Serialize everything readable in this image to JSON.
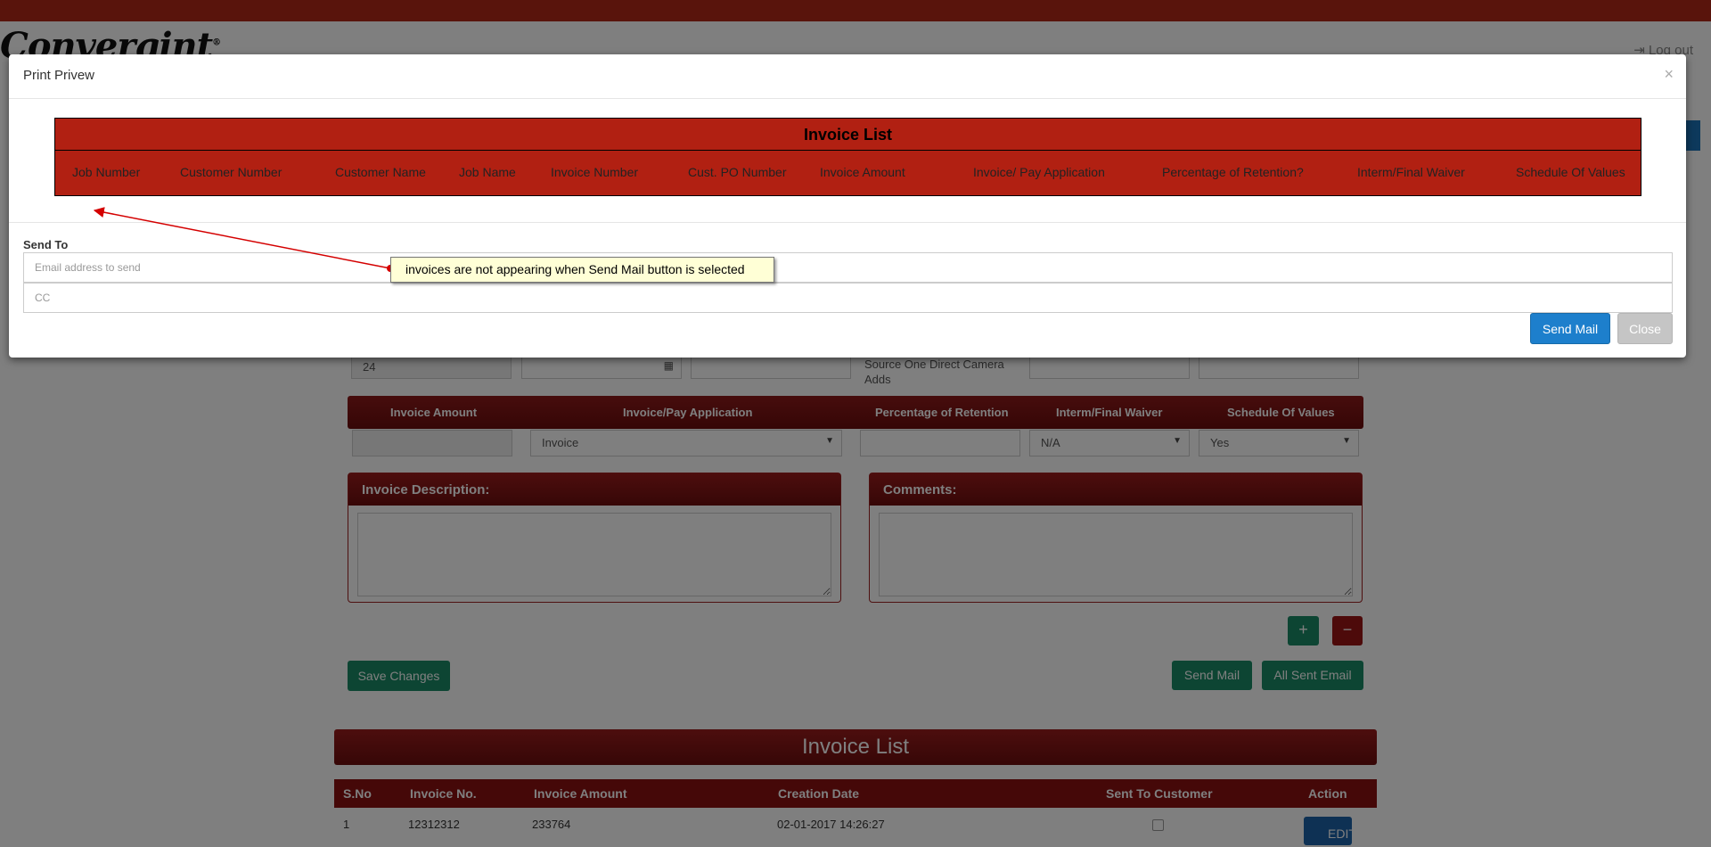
{
  "app": {
    "logo_text": "Convergint",
    "logout_label": "Log out",
    "logout_icon": "sign-out-icon"
  },
  "background_form": {
    "row1": {
      "field1_value": "24",
      "field6_value": "Source One Direct Camera Adds"
    },
    "header_row": {
      "invoice_amount": "Invoice Amount",
      "pay_application": "Invoice/Pay Application",
      "percentage_retention": "Percentage of Retention",
      "waiver": "Interm/Final Waiver",
      "schedule": "Schedule Of Values"
    },
    "row2": {
      "pay_application_value": "Invoice",
      "waiver_value": "N/A",
      "schedule_value": "Yes"
    },
    "invoice_description_label": "Invoice Description:",
    "comments_label": "Comments:",
    "add_label": "+",
    "remove_label": "−",
    "save_changes_label": "Save Changes",
    "send_mail_label": "Send Mail",
    "all_sent_email_label": "All Sent Email"
  },
  "invoice_list": {
    "title": "Invoice List",
    "columns": [
      "S.No",
      "Invoice No.",
      "Invoice Amount",
      "Creation Date",
      "Sent To Customer",
      "Action"
    ],
    "rows": [
      {
        "sno": "1",
        "invoice_no": "12312312",
        "amount": "233764",
        "created": "02-01-2017 14:26:27",
        "sent": false,
        "action": "EDIT"
      }
    ]
  },
  "modal": {
    "title": "Print Privew",
    "close_glyph": "×",
    "preview_title": "Invoice List",
    "preview_columns": [
      "Job Number",
      "Customer Number",
      "Customer Name",
      "Job Name",
      "Invoice Number",
      "Cust. PO Number",
      "Invoice Amount",
      "Invoice/ Pay Application",
      "Percentage of Retention?",
      "Interm/Final Waiver",
      "Schedule Of Values"
    ],
    "send_to_label": "Send To",
    "email_placeholder": "Email address to send",
    "cc_placeholder": "CC",
    "send_mail_label": "Send Mail",
    "close_label": "Close"
  },
  "annotation": {
    "note": "invoices are not appearing when Send Mail button is selected",
    "color": "#d40000"
  },
  "colors": {
    "brand_red": "#b12012",
    "dark_red": "#8a1010",
    "primary_blue": "#1d7fcc",
    "success_green": "#1b8a66"
  }
}
